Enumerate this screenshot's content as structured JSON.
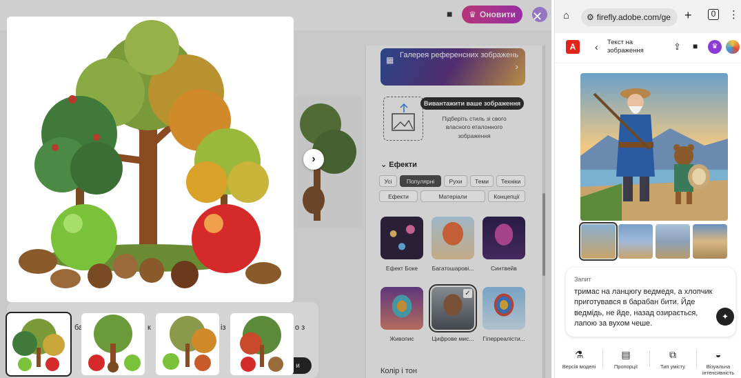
{
  "desktop": {
    "header": {
      "upgrade_label": "Оновити"
    },
    "panel": {
      "gallery_banner": "Галерея референсних зображень",
      "upload": {
        "button_label": "Вивантажити ваше зображення",
        "hint": "Підберіть стиль зі свого власного еталонного зображення"
      },
      "effects": {
        "title": "Ефекти",
        "filters_row1": [
          "Усі",
          "Популярні",
          "Рухи",
          "Теми",
          "Техніки"
        ],
        "filters_row2": [
          "Ефекти",
          "Матеріали",
          "Концепції"
        ],
        "active_filter": "Популярні",
        "styles_row1": [
          "Ефект Боке",
          "Багатошарові...",
          "Синтвейв"
        ],
        "styles_row2": [
          "Живопис",
          "Цифрове мис...",
          "Гіперреалісти..."
        ],
        "selected_style": "Цифрове мис..."
      },
      "color_tone_title": "Колір і тон"
    },
    "prompt_fragments": [
      "ба",
      "к",
      "із",
      "о з",
      "и"
    ]
  },
  "mobile": {
    "url": "firefly.adobe.com/ge",
    "title": "Текст на зображення",
    "prompt": {
      "label": "Запит",
      "text": "тримас на ланцюгу ведмедя, а хлопчик приготувався в барабан бити. Йде ведмідь, не йде, назад озирається, лапою за вухом чеше."
    },
    "bottom_bar": [
      {
        "icon": "model-version-icon",
        "label": "Версія моделі"
      },
      {
        "icon": "aspect-ratio-icon",
        "label": "Пропорції"
      },
      {
        "icon": "content-type-icon",
        "label": "Тип умісту"
      },
      {
        "icon": "visual-intensity-icon",
        "label": "Візуальна інтенсивність"
      }
    ]
  },
  "colors": {
    "upgrade_gradient_start": "#d63a8a",
    "upgrade_gradient_end": "#b12fbe",
    "adobe_red": "#e0251b",
    "active_chip": "#4a4a4a"
  }
}
